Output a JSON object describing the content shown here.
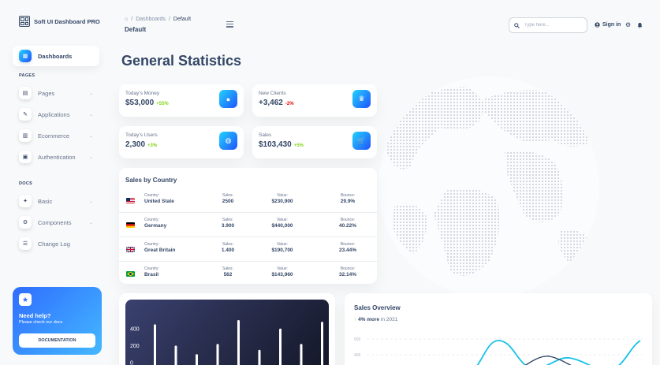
{
  "brand": {
    "name": "Soft UI Dashboard PRO"
  },
  "sidebar": {
    "items_top": [
      {
        "label": "Dashboards",
        "icon": "dashboards-icon",
        "active": true
      }
    ],
    "section_pages": "PAGES",
    "pages_items": [
      {
        "label": "Pages",
        "icon": "pages-icon"
      },
      {
        "label": "Applications",
        "icon": "applications-icon"
      },
      {
        "label": "Ecommerce",
        "icon": "ecommerce-icon"
      },
      {
        "label": "Authentication",
        "icon": "authentication-icon"
      }
    ],
    "section_docs": "DOCS",
    "docs_items": [
      {
        "label": "Basic",
        "icon": "basic-icon"
      },
      {
        "label": "Components",
        "icon": "components-icon"
      },
      {
        "label": "Change Log",
        "icon": "changelog-icon"
      }
    ]
  },
  "help": {
    "title": "Need help?",
    "subtitle": "Please check our docs",
    "button": "DOCUMENTATION"
  },
  "header": {
    "breadcrumb": [
      "Dashboards",
      "Default"
    ],
    "page_name": "Default",
    "search_placeholder": "Type here...",
    "signin_label": "Sign in"
  },
  "main": {
    "title": "General Statistics"
  },
  "stats": [
    {
      "label": "Today's Money",
      "value": "$53,000",
      "change": "+55%",
      "trend": "pos",
      "icon": "money-icon"
    },
    {
      "label": "New Clients",
      "value": "+3,462",
      "change": "-2%",
      "trend": "neg",
      "icon": "trophy-icon"
    },
    {
      "label": "Today's Users",
      "value": "2,300",
      "change": "+3%",
      "trend": "pos",
      "icon": "globe-icon"
    },
    {
      "label": "Sales",
      "value": "$103,430",
      "change": "+5%",
      "trend": "pos",
      "icon": "cart-icon"
    }
  ],
  "sales_by_country": {
    "title": "Sales by Country",
    "headers": {
      "country": "Country:",
      "sales": "Sales:",
      "value": "Value:",
      "bounce": "Bounce:"
    },
    "rows": [
      {
        "country": "United State",
        "sales": "2500",
        "value": "$230,900",
        "bounce": "29.9%",
        "flag": "us"
      },
      {
        "country": "Germany",
        "sales": "3.900",
        "value": "$440,000",
        "bounce": "40.22%",
        "flag": "de"
      },
      {
        "country": "Great Britain",
        "sales": "1.400",
        "value": "$190,700",
        "bounce": "23.44%",
        "flag": "gb"
      },
      {
        "country": "Brasil",
        "sales": "562",
        "value": "$143,960",
        "bounce": "32.14%",
        "flag": "br"
      }
    ]
  },
  "chart_data": [
    {
      "type": "bar",
      "title": "",
      "yticks": [
        "400",
        "200",
        "0"
      ],
      "ylim": [
        0,
        500
      ],
      "values": [
        450,
        200,
        100,
        220,
        500,
        150,
        400,
        220,
        480
      ]
    },
    {
      "type": "line",
      "title": "Sales Overview",
      "subtitle_change": "4% more",
      "subtitle_rest": "in 2021",
      "yticks": [
        "500",
        "400"
      ]
    }
  ],
  "colors": {
    "accent_start": "#2152ff",
    "accent_end": "#21d4fd",
    "positive": "#82d616",
    "negative": "#ea0606",
    "text": "#344767"
  }
}
